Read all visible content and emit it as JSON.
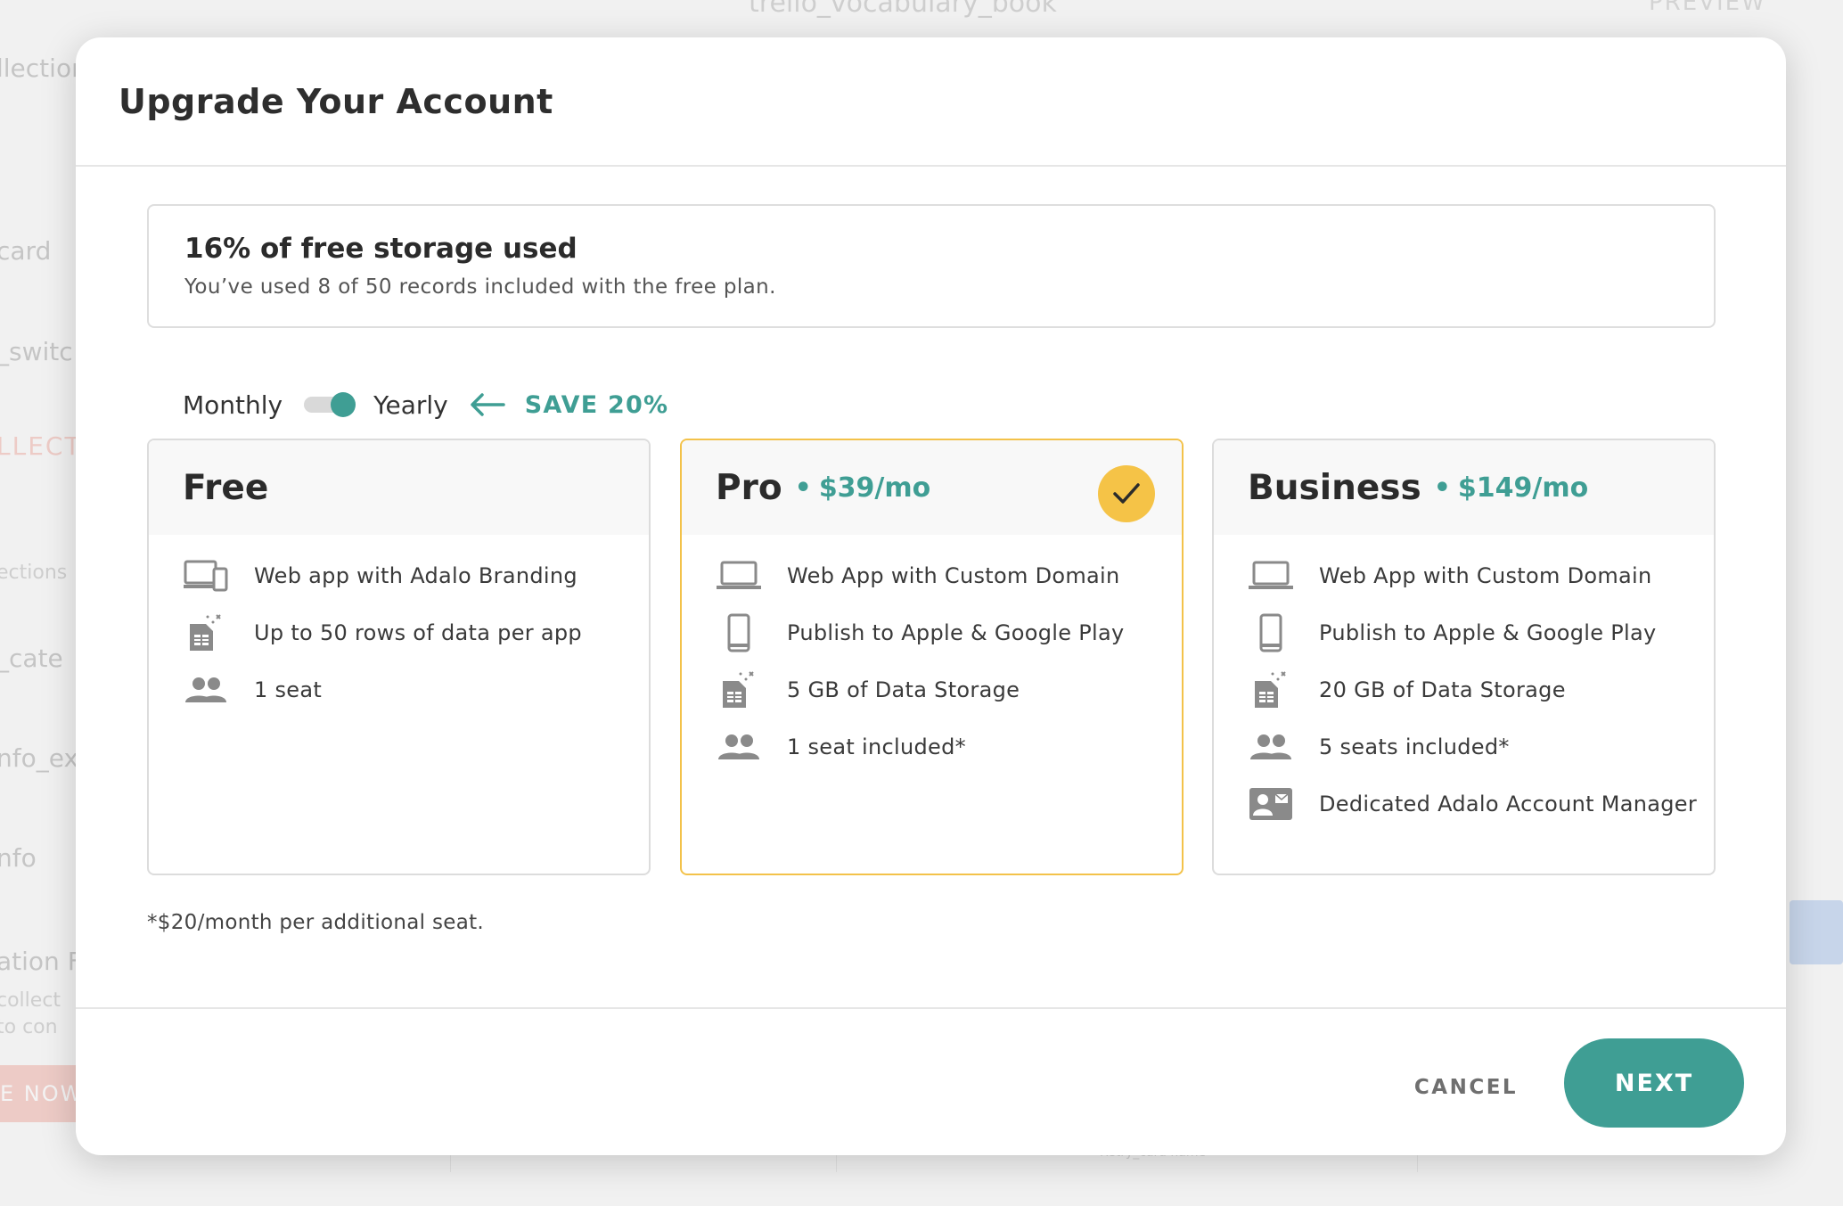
{
  "background": {
    "app_title": "trello_vocabulary_book",
    "preview_label": "PREVIEW",
    "left_items": [
      "llection",
      "card",
      "_switc",
      "LLECTI",
      "ections",
      "_cate",
      "nfo_ex",
      "nfo",
      "ation F",
      "collect",
      "to con"
    ],
    "upgrade_button": "E NOW",
    "footer_field": "Retry_card name"
  },
  "modal": {
    "title": "Upgrade Your Account",
    "storage": {
      "title": "16% of free storage used",
      "subtitle": "You’ve used 8 of 50 records included with the free plan.",
      "percent_used": 16
    },
    "billing": {
      "monthly_label": "Monthly",
      "yearly_label": "Yearly",
      "selected": "Yearly",
      "save_label": "SAVE 20%"
    },
    "plans": [
      {
        "name": "Free",
        "price": "",
        "selected": false,
        "features": [
          {
            "icon": "devices-icon",
            "text": "Web app with Adalo Branding"
          },
          {
            "icon": "data-sheet-icon",
            "text": "Up to 50 rows of data per app"
          },
          {
            "icon": "people-icon",
            "text": "1 seat"
          }
        ]
      },
      {
        "name": "Pro",
        "price": "$39/mo",
        "selected": true,
        "features": [
          {
            "icon": "laptop-icon",
            "text": "Web App with Custom Domain"
          },
          {
            "icon": "phone-icon",
            "text": "Publish to Apple & Google Play"
          },
          {
            "icon": "data-sheet-icon",
            "text": "5 GB of Data Storage"
          },
          {
            "icon": "people-icon",
            "text": "1 seat included*"
          }
        ]
      },
      {
        "name": "Business",
        "price": "$149/mo",
        "selected": false,
        "features": [
          {
            "icon": "laptop-icon",
            "text": "Web App with Custom Domain"
          },
          {
            "icon": "phone-icon",
            "text": "Publish to Apple & Google Play"
          },
          {
            "icon": "data-sheet-icon",
            "text": "20 GB of Data Storage"
          },
          {
            "icon": "people-icon",
            "text": "5 seats included*"
          },
          {
            "icon": "contact-card-icon",
            "text": "Dedicated Adalo Account Manager"
          }
        ]
      }
    ],
    "footnote": "*$20/month per additional seat.",
    "cancel_label": "CANCEL",
    "next_label": "NEXT"
  },
  "colors": {
    "accent": "#3f9e94",
    "selected_border": "#f3c24a",
    "check_badge": "#f5c347",
    "danger": "#e56b5a"
  }
}
